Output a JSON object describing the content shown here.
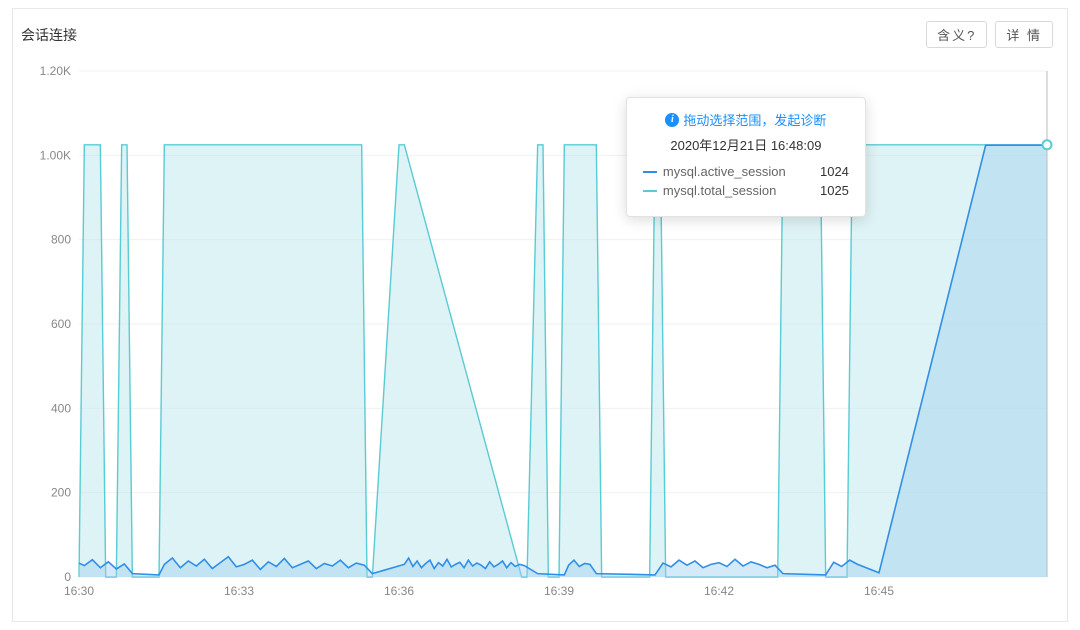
{
  "header": {
    "title": "会话连接",
    "help_btn": "含义?",
    "detail_btn": "详 情"
  },
  "tooltip": {
    "hint": "拖动选择范围，发起诊断",
    "timestamp": "2020年12月21日 16:48:09",
    "rows": [
      {
        "label": "mysql.active_session",
        "value": "1024",
        "color": "#2f8fe8"
      },
      {
        "label": "mysql.total_session",
        "value": "1025",
        "color": "#59cbd3"
      }
    ]
  },
  "chart_data": {
    "type": "area",
    "title": "会话连接",
    "xlabel": "",
    "ylabel": "",
    "ylim": [
      0,
      1200
    ],
    "y_ticks": [
      0,
      200,
      400,
      600,
      800,
      1000,
      1200
    ],
    "y_tick_labels": [
      "0",
      "200",
      "400",
      "600",
      "800",
      "1.00K",
      "1.20K"
    ],
    "x_ticks": [
      "16:30",
      "16:33",
      "16:36",
      "16:39",
      "16:42",
      "16:45"
    ],
    "x_range_minutes": [
      990,
      1008.15
    ],
    "series": [
      {
        "name": "mysql.total_session",
        "color": "#59cbd3",
        "x_minutes": [
          990.0,
          990.1,
          990.4,
          990.5,
          990.7,
          990.8,
          990.9,
          991.0,
          991.5,
          991.6,
          995.3,
          995.4,
          995.5,
          996.0,
          996.1,
          998.3,
          998.4,
          998.6,
          998.7,
          998.8,
          999.0,
          999.1,
          999.7,
          999.8,
          1000.7,
          1000.8,
          1000.9,
          1001.0,
          1003.1,
          1003.2,
          1003.9,
          1004.0,
          1004.4,
          1004.5,
          1004.9,
          1005.0,
          1008.15
        ],
        "values": [
          0,
          1025,
          1025,
          0,
          0,
          1025,
          1025,
          0,
          0,
          1025,
          1025,
          0,
          0,
          1025,
          1025,
          0,
          0,
          1025,
          1025,
          0,
          0,
          1025,
          1025,
          0,
          0,
          1025,
          1025,
          0,
          0,
          1025,
          1025,
          0,
          0,
          1025,
          1025,
          1025,
          1025
        ]
      },
      {
        "name": "mysql.active_session",
        "color": "#2f8fe8",
        "x_minutes": [
          990.0,
          990.1,
          990.25,
          990.4,
          990.55,
          990.7,
          990.85,
          991.0,
          991.5,
          991.6,
          991.75,
          991.9,
          992.05,
          992.2,
          992.35,
          992.5,
          992.65,
          992.8,
          992.95,
          993.1,
          993.25,
          993.4,
          993.55,
          993.7,
          993.85,
          994.0,
          994.15,
          994.3,
          994.45,
          994.6,
          994.75,
          994.9,
          995.05,
          995.2,
          995.35,
          995.5,
          996.1,
          996.18,
          996.26,
          996.34,
          996.42,
          996.5,
          996.58,
          996.66,
          996.74,
          996.82,
          996.9,
          996.98,
          997.06,
          997.14,
          997.22,
          997.3,
          997.38,
          997.46,
          997.54,
          997.62,
          997.7,
          997.78,
          997.86,
          997.94,
          998.02,
          998.1,
          998.18,
          998.26,
          998.35,
          998.6,
          999.1,
          999.18,
          999.28,
          999.38,
          999.48,
          999.58,
          999.7,
          1000.8,
          1000.95,
          1001.1,
          1001.25,
          1001.4,
          1001.55,
          1001.7,
          1001.85,
          1002.0,
          1002.15,
          1002.3,
          1002.45,
          1002.6,
          1002.75,
          1002.9,
          1003.05,
          1003.2,
          1004.0,
          1004.15,
          1004.3,
          1004.45,
          1004.6,
          1005.0,
          1007.0,
          1008.15
        ],
        "values": [
          33,
          27,
          41,
          22,
          36,
          19,
          31,
          8,
          5,
          30,
          45,
          22,
          38,
          26,
          42,
          20,
          34,
          48,
          24,
          30,
          40,
          18,
          36,
          25,
          44,
          22,
          30,
          38,
          20,
          32,
          26,
          40,
          22,
          33,
          28,
          8,
          30,
          45,
          25,
          38,
          22,
          32,
          40,
          20,
          34,
          26,
          42,
          24,
          30,
          35,
          22,
          40,
          26,
          33,
          28,
          20,
          36,
          24,
          30,
          38,
          22,
          34,
          25,
          30,
          27,
          8,
          5,
          28,
          40,
          25,
          32,
          30,
          8,
          5,
          33,
          24,
          40,
          28,
          38,
          22,
          30,
          34,
          25,
          42,
          26,
          36,
          30,
          22,
          28,
          8,
          5,
          35,
          25,
          40,
          30,
          10,
          1024,
          1024
        ]
      }
    ],
    "cursor_x_minute": 1008.15
  }
}
